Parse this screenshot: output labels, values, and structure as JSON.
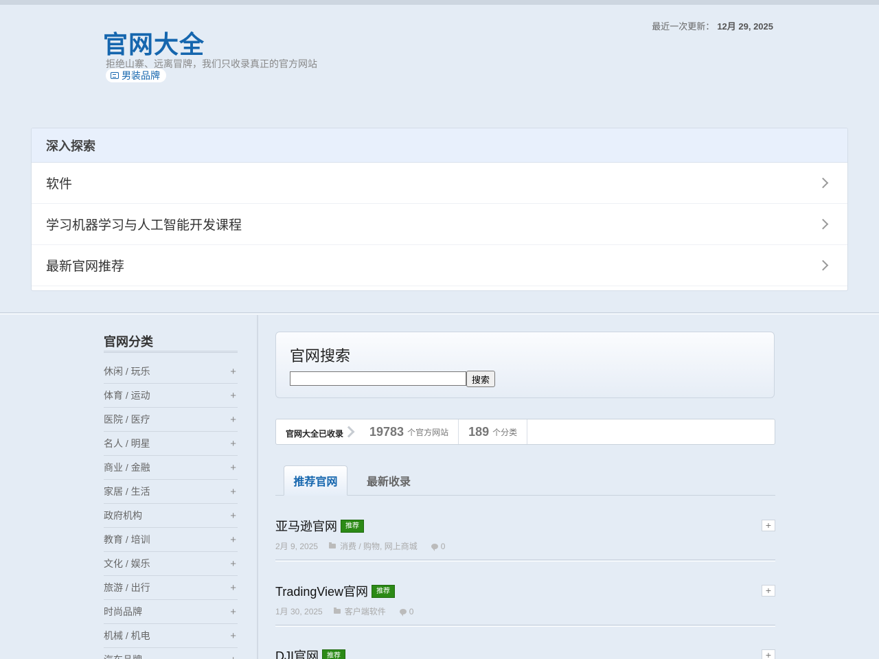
{
  "header": {
    "title": "官网大全",
    "description": "拒绝山寨、远离冒牌，我们只收录真正的官方网站",
    "brand_tag": "男装品牌",
    "update_label": "最近一次更新：",
    "update_date": "12月 29, 2025"
  },
  "explore": {
    "heading": "深入探索",
    "items": [
      {
        "label": "软件"
      },
      {
        "label": "学习机器学习与人工智能开发课程"
      },
      {
        "label": "最新官网推荐"
      }
    ]
  },
  "sidebar": {
    "title": "官网分类",
    "items": [
      {
        "label": "休闲 / 玩乐"
      },
      {
        "label": "体育 / 运动"
      },
      {
        "label": "医院 / 医疗"
      },
      {
        "label": "名人 / 明星"
      },
      {
        "label": "商业 / 金融"
      },
      {
        "label": "家居 / 生活"
      },
      {
        "label": "政府机构"
      },
      {
        "label": "教育 / 培训"
      },
      {
        "label": "文化 / 娱乐"
      },
      {
        "label": "旅游 / 出行"
      },
      {
        "label": "时尚品牌"
      },
      {
        "label": "机械 / 机电"
      },
      {
        "label": "汽车品牌"
      }
    ],
    "plus_symbol": "+"
  },
  "search": {
    "title": "官网搜索",
    "input_value": "",
    "button_label": "搜索"
  },
  "stats": {
    "lead": "官网大全已收录",
    "sites_count": "19783",
    "sites_unit": "个官方网站",
    "categories_count": "189",
    "categories_unit": "个分类"
  },
  "tabs": [
    {
      "label": "推荐官网",
      "active": true
    },
    {
      "label": "最新收录",
      "active": false
    }
  ],
  "posts": [
    {
      "title": "亚马逊官网",
      "badge": "推荐",
      "date": "2月 9, 2025",
      "category": "消费 / 购物, 网上商城",
      "comments": "0"
    },
    {
      "title": "TradingView官网",
      "badge": "推荐",
      "date": "1月 30, 2025",
      "category": "客户端软件",
      "comments": "0"
    },
    {
      "title": "DJI官网",
      "badge": "推荐",
      "date": "",
      "category": "",
      "comments": ""
    }
  ],
  "colors": {
    "accent": "#1566ae",
    "badge_green": "#2c8a16",
    "background": "#e4ecf5"
  }
}
